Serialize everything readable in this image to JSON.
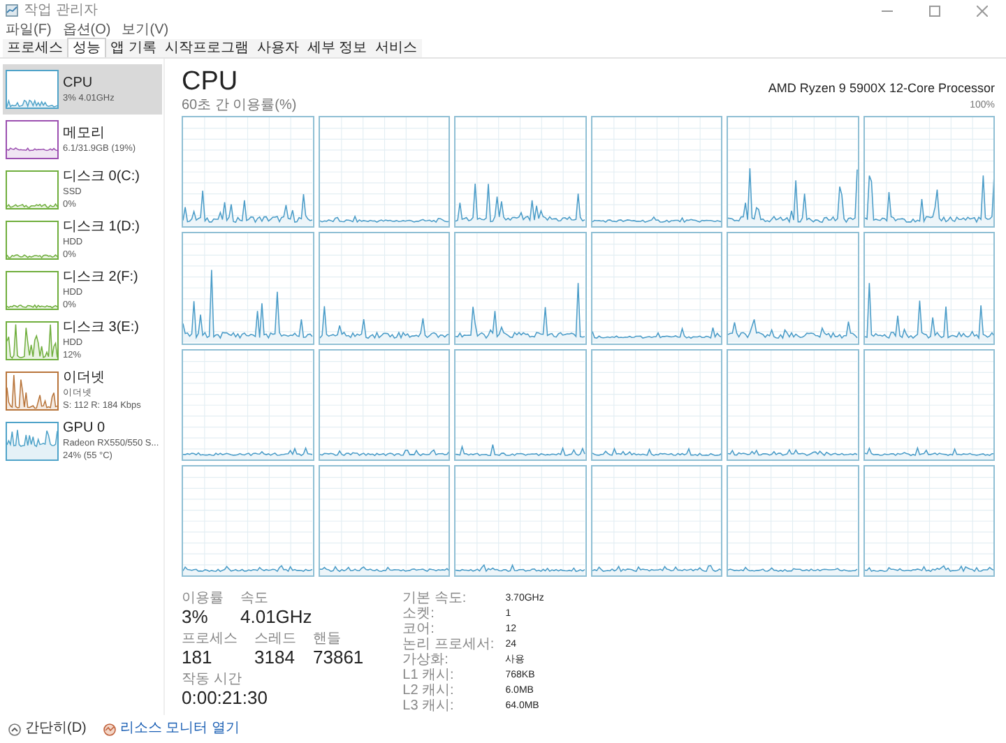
{
  "window": {
    "title": "작업 관리자"
  },
  "menu": [
    "파일(F)",
    "옵션(O)",
    "보기(V)"
  ],
  "tabs": [
    {
      "label": "프로세스",
      "selected": false
    },
    {
      "label": "성능",
      "selected": true
    },
    {
      "label": "앱 기록",
      "selected": false
    },
    {
      "label": "시작프로그램",
      "selected": false
    },
    {
      "label": "사용자",
      "selected": false
    },
    {
      "label": "세부 정보",
      "selected": false
    },
    {
      "label": "서비스",
      "selected": false
    }
  ],
  "sidebar": {
    "items": [
      {
        "name": "CPU",
        "lines": [
          "3% 4.01GHz"
        ],
        "color": "#4fa3c9",
        "selected": true
      },
      {
        "name": "메모리",
        "lines": [
          "6.1/31.9GB (19%)"
        ],
        "color": "#9b4fb0",
        "selected": false
      },
      {
        "name": "디스크 0(C:)",
        "lines": [
          "SSD",
          "0%"
        ],
        "color": "#6fae3c",
        "selected": false
      },
      {
        "name": "디스크 1(D:)",
        "lines": [
          "HDD",
          "0%"
        ],
        "color": "#6fae3c",
        "selected": false
      },
      {
        "name": "디스크 2(F:)",
        "lines": [
          "HDD",
          "0%"
        ],
        "color": "#6fae3c",
        "selected": false
      },
      {
        "name": "디스크 3(E:)",
        "lines": [
          "HDD",
          "12%"
        ],
        "color": "#6fae3c",
        "selected": false
      },
      {
        "name": "이더넷",
        "lines": [
          "이더넷",
          "S: 112 R: 184 Kbps"
        ],
        "color": "#b8743a",
        "selected": false
      },
      {
        "name": "GPU 0",
        "lines": [
          "Radeon RX550/550 S...",
          "24% (55 °C)"
        ],
        "color": "#4fa3c9",
        "selected": false
      }
    ]
  },
  "main": {
    "title": "CPU",
    "processor": "AMD Ryzen 9 5900X 12-Core Processor",
    "graph_label": "60초 간 이용률(%)",
    "graph_max": "100%"
  },
  "stats": {
    "rows": [
      [
        {
          "label": "이용률",
          "value": "3%"
        },
        {
          "label": "속도",
          "value": "4.01GHz"
        }
      ],
      [
        {
          "label": "프로세스",
          "value": "181"
        },
        {
          "label": "스레드",
          "value": "3184"
        },
        {
          "label": "핸들",
          "value": "73861"
        }
      ],
      [
        {
          "label": "작동 시간",
          "value": "0:00:21:30"
        }
      ]
    ],
    "details": [
      {
        "label": "기본 속도:",
        "value": "3.70GHz"
      },
      {
        "label": "소켓:",
        "value": "1"
      },
      {
        "label": "코어:",
        "value": "12"
      },
      {
        "label": "논리 프로세서:",
        "value": "24"
      },
      {
        "label": "가상화:",
        "value": "사용"
      },
      {
        "label": "L1 캐시:",
        "value": "768KB"
      },
      {
        "label": "L2 캐시:",
        "value": "6.0MB"
      },
      {
        "label": "L3 캐시:",
        "value": "64.0MB"
      }
    ]
  },
  "footer": [
    {
      "label": "간단히(D)",
      "kind": "collapse"
    },
    {
      "label": "리소스 모니터 열기",
      "kind": "link"
    }
  ]
}
